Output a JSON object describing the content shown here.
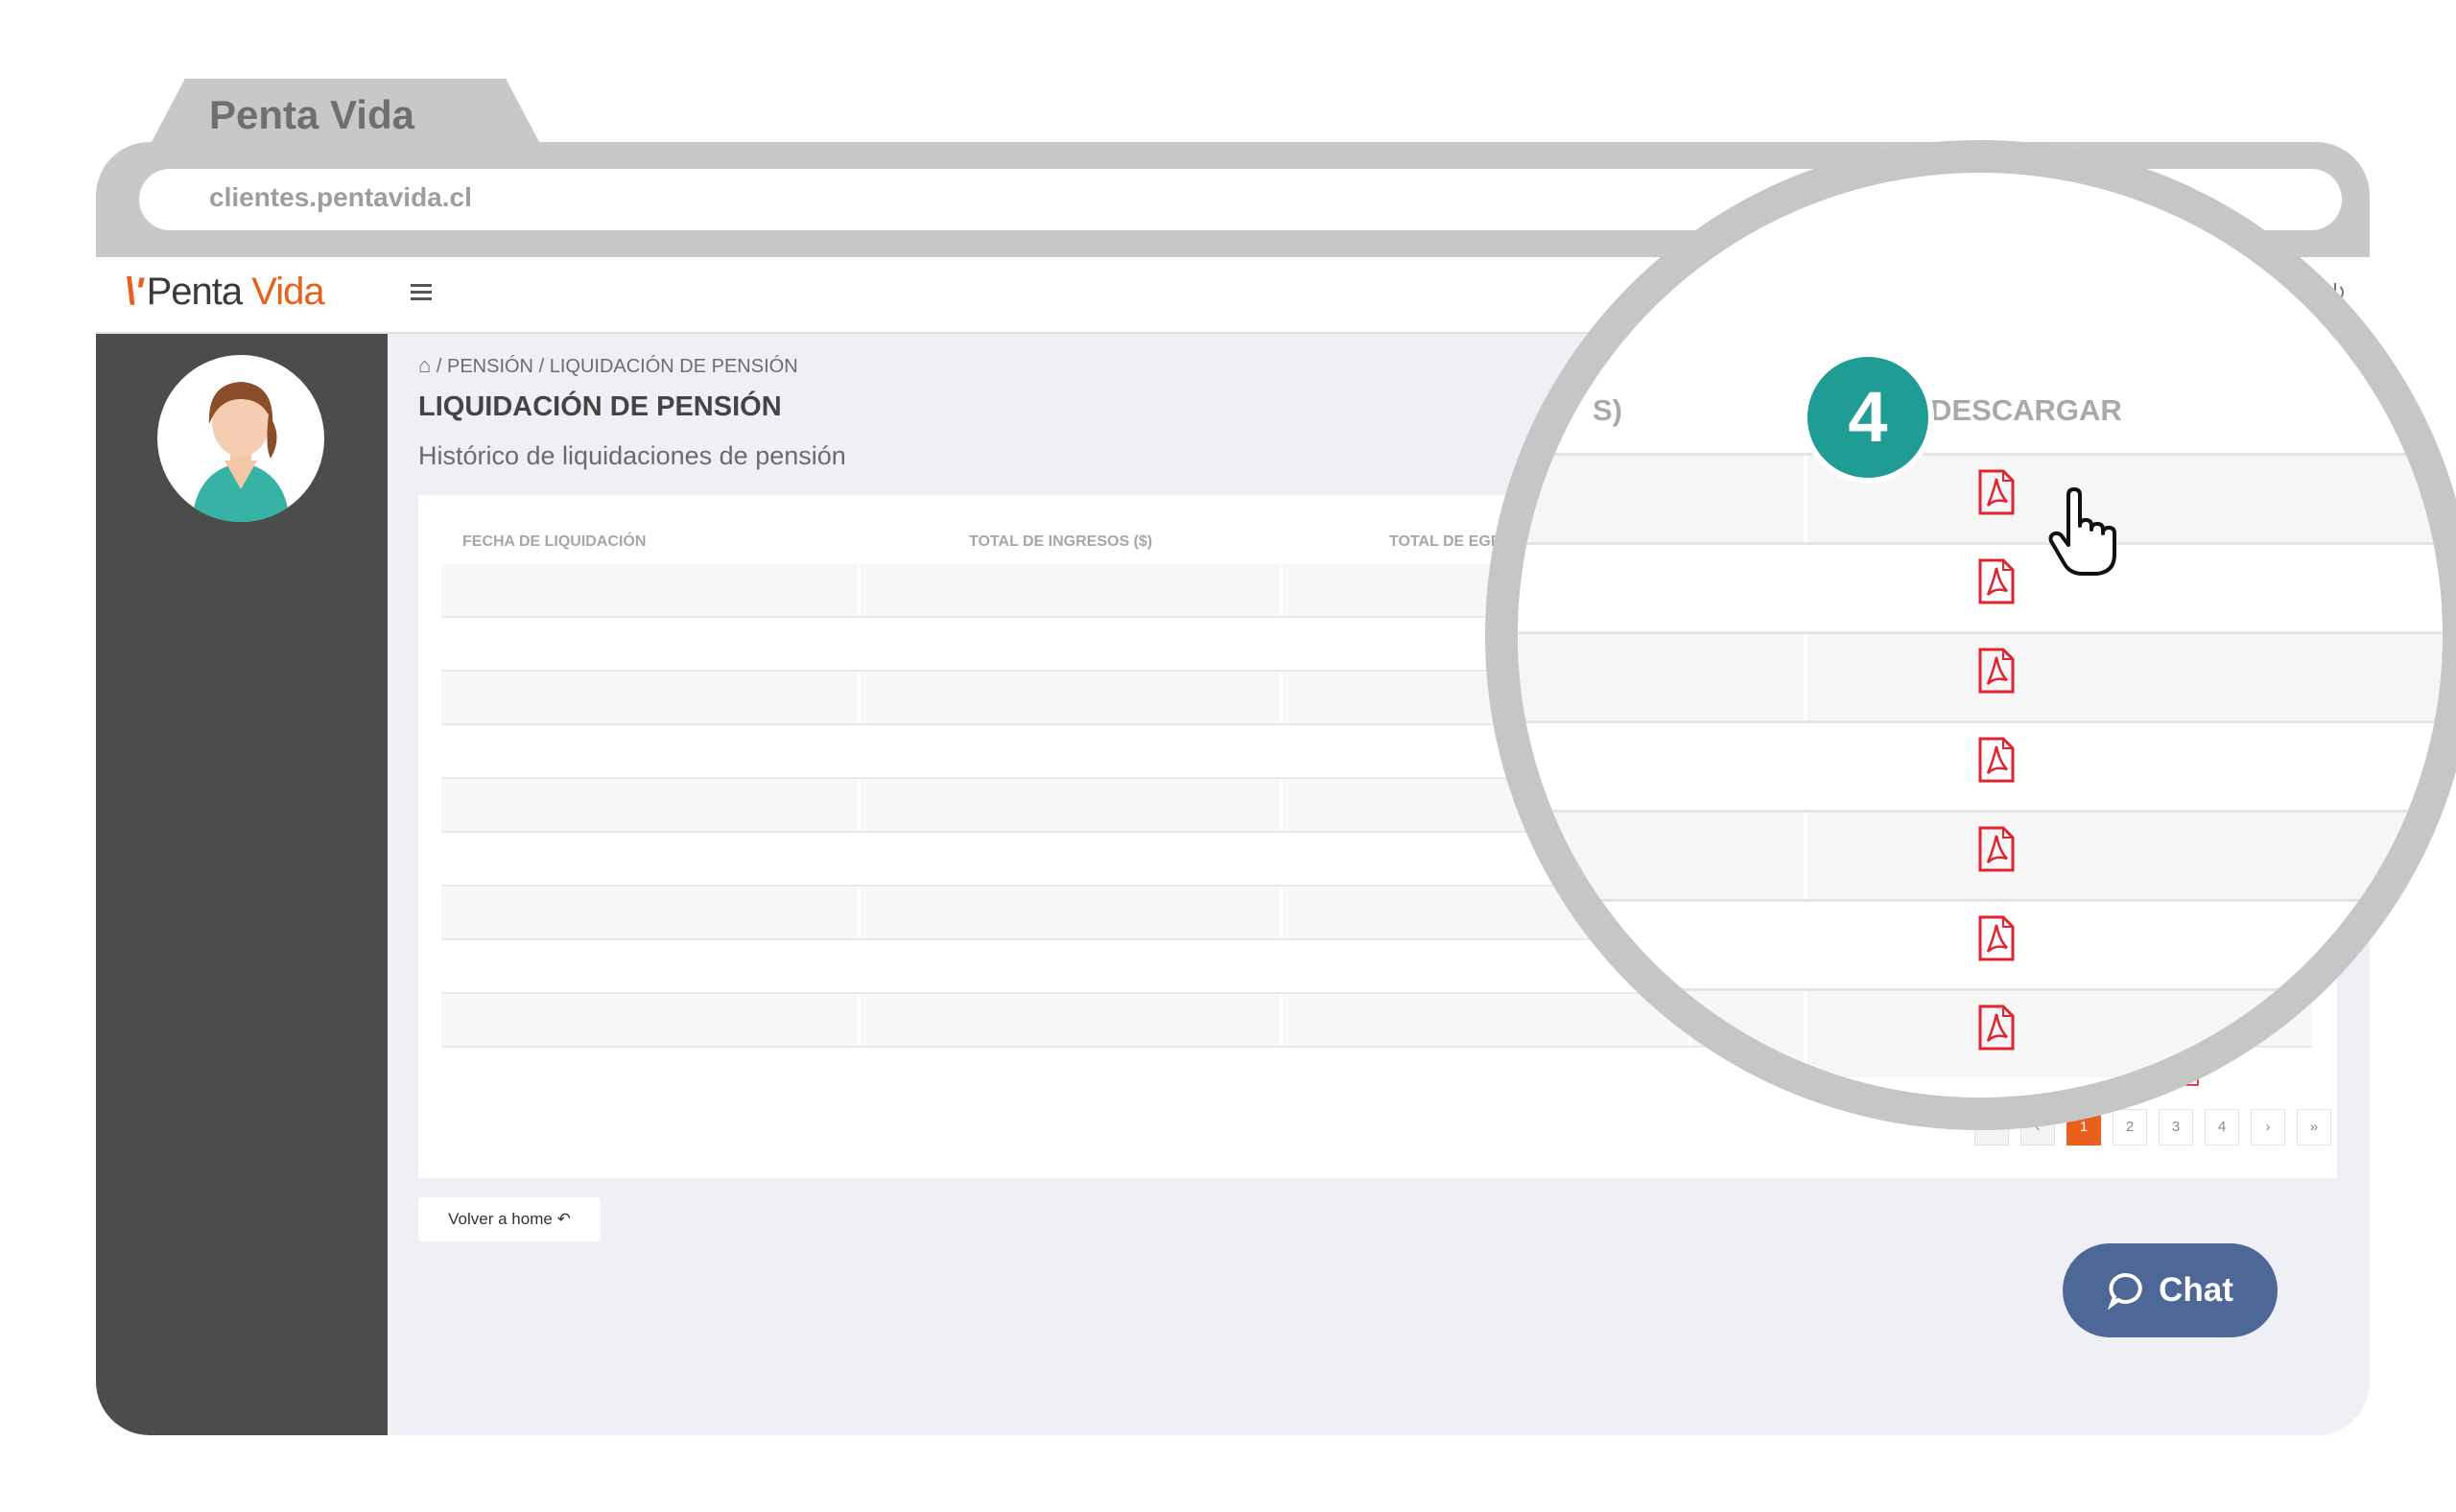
{
  "browser": {
    "tab_title": "Penta Vida",
    "url": "clientes.pentavida.cl"
  },
  "topbar": {
    "logo_mark": "\\'",
    "logo_penta": "Penta",
    "logo_vida": "Vida",
    "menu_icon": "hamburger-icon",
    "power_icon": "power-icon"
  },
  "breadcrumb": {
    "home_icon": "home-icon",
    "separator": "/",
    "items": [
      "PENSIÓN",
      "LIQUIDACIÓN DE PENSIÓN"
    ]
  },
  "page": {
    "title": "LIQUIDACIÓN DE PENSIÓN",
    "subtitle": "Histórico de liquidaciones de pensión"
  },
  "table": {
    "columns": [
      "FECHA DE LIQUIDACIÓN",
      "TOTAL DE INGRESOS ($)",
      "TOTAL DE EGRES"
    ]
  },
  "pagination": {
    "first": "«",
    "prev": "‹",
    "pages": [
      "1",
      "2",
      "3",
      "4"
    ],
    "current": "1",
    "next": "›",
    "last": "»"
  },
  "actions": {
    "back_home": "Volver a home",
    "chat": "Chat"
  },
  "magnifier": {
    "partial_header": "S)",
    "download_header": "DESCARGAR",
    "pdf_icon": "pdf-icon",
    "step_number": "4"
  },
  "colors": {
    "brand_orange": "#e8601c",
    "sidebar": "#4b4d4b",
    "step_teal": "#1f9c93",
    "chat_blue": "#4d6797",
    "pdf_red": "#e0232f"
  }
}
